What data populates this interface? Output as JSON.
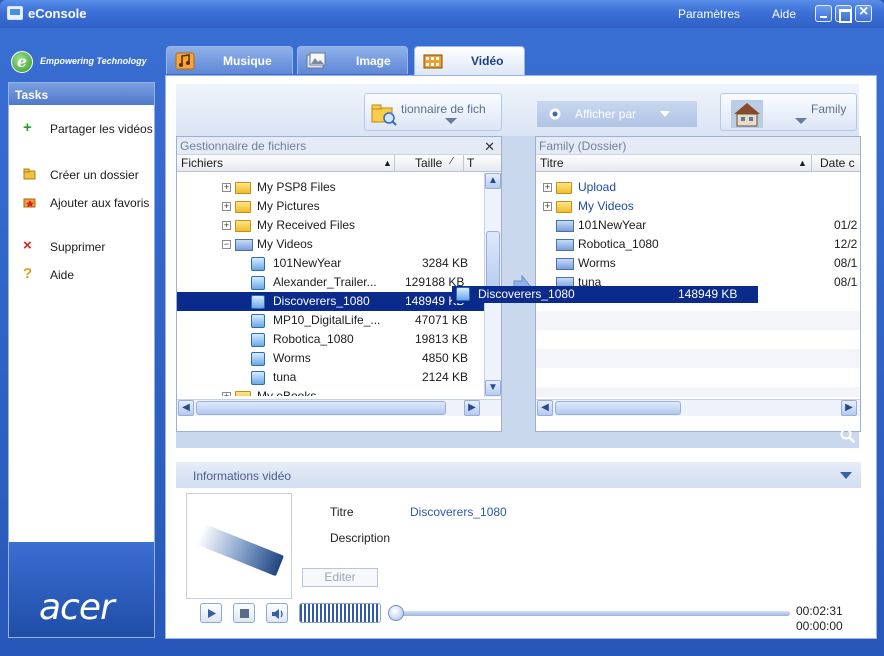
{
  "window": {
    "title": "eConsole",
    "menu": [
      "Paramètres",
      "Aide"
    ]
  },
  "brand": {
    "tagline": "Empowering Technology",
    "logo_letter": "e",
    "vendor": "acer"
  },
  "tabs": [
    {
      "label": "Musique",
      "active": false
    },
    {
      "label": "Image",
      "active": false
    },
    {
      "label": "Vidéo",
      "active": true
    }
  ],
  "sidebar": {
    "header": "Tasks",
    "tasks": [
      {
        "label": "Partager les vidéos",
        "icon": "plus-icon",
        "color": "#2a9a2a"
      },
      {
        "label": "Créer un dossier",
        "icon": "new-folder-icon",
        "color": "#e0a020"
      },
      {
        "label": "Ajouter aux favoris",
        "icon": "favorites-icon",
        "color": "#d84a2a"
      },
      {
        "label": "Supprimer",
        "icon": "delete-icon",
        "color": "#d42020"
      },
      {
        "label": "Aide",
        "icon": "help-icon",
        "color": "#e0a020"
      }
    ]
  },
  "toolbar": {
    "source_button": "tionnaire de fich",
    "view_by": "Afficher par",
    "family_button": "Family"
  },
  "left_pane": {
    "title": "Gestionnaire de fichiers",
    "columns": [
      "Fichiers",
      "Taille",
      "T"
    ],
    "rows": [
      {
        "name": "My PSP8 Files",
        "size": "",
        "type": "folder",
        "level": 1
      },
      {
        "name": "My Pictures",
        "size": "",
        "type": "folder",
        "level": 1
      },
      {
        "name": "My Received Files",
        "size": "",
        "type": "folder",
        "level": 1
      },
      {
        "name": "My Videos",
        "size": "",
        "type": "folder-open",
        "level": 1
      },
      {
        "name": "101NewYear",
        "size": "3284 KB",
        "type": "video",
        "level": 2
      },
      {
        "name": "Alexander_Trailer...",
        "size": "129188 KB",
        "type": "video",
        "level": 2
      },
      {
        "name": "Discoverers_1080",
        "size": "148949 KB",
        "type": "video",
        "level": 2,
        "selected": true
      },
      {
        "name": "MP10_DigitalLife_...",
        "size": "47071 KB",
        "type": "video",
        "level": 2
      },
      {
        "name": "Robotica_1080",
        "size": "19813 KB",
        "type": "video",
        "level": 2
      },
      {
        "name": "Worms",
        "size": "4850 KB",
        "type": "video",
        "level": 2
      },
      {
        "name": "tuna",
        "size": "2124 KB",
        "type": "video",
        "level": 2
      },
      {
        "name": "My eBooks",
        "size": "",
        "type": "folder",
        "level": 1
      }
    ]
  },
  "right_pane": {
    "title": "Family (Dossier)",
    "columns": [
      "Titre",
      "Date c"
    ],
    "rows": [
      {
        "name": "Upload",
        "date": "",
        "type": "folder"
      },
      {
        "name": "My Videos",
        "date": "",
        "type": "folder-link"
      },
      {
        "name": "101NewYear",
        "date": "01/2",
        "type": "film"
      },
      {
        "name": "Robotica_1080",
        "date": "12/2",
        "type": "film"
      },
      {
        "name": "Worms",
        "date": "08/1",
        "type": "film"
      },
      {
        "name": "tuna",
        "date": "08/1",
        "type": "film"
      }
    ]
  },
  "drag_ghost": {
    "name": "Discoverers_1080",
    "size": "148949 KB"
  },
  "info": {
    "header": "Informations vidéo",
    "title_label": "Titre",
    "title_value": "Discoverers_1080",
    "description_label": "Description",
    "edit_button": "Editer"
  },
  "player": {
    "time_total": "00:02:31",
    "time_current": "00:00:00",
    "progress": 0
  }
}
